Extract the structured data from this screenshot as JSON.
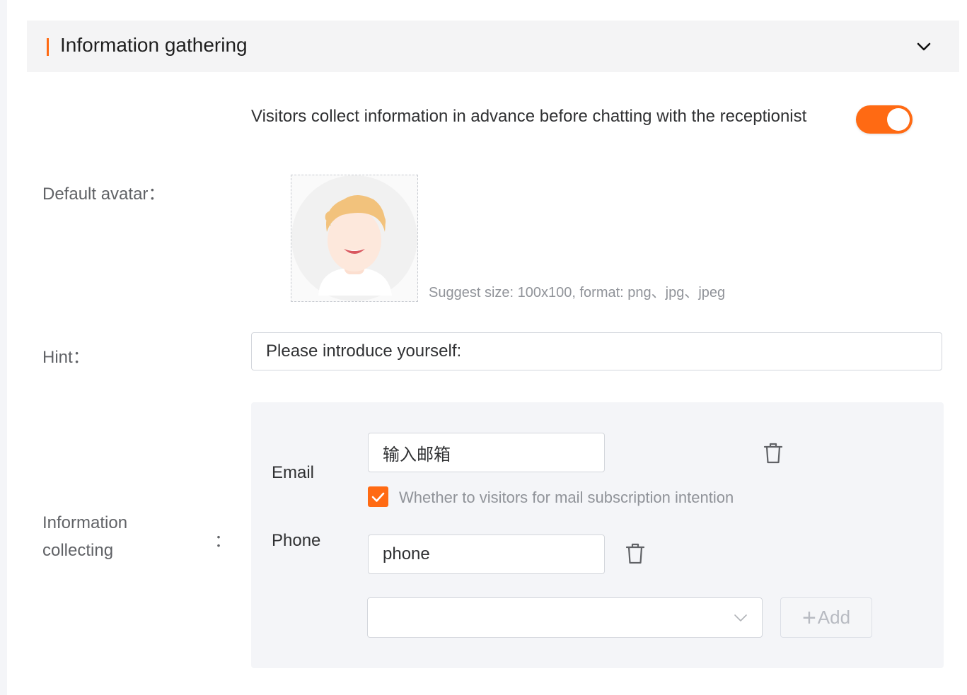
{
  "section": {
    "title": "Information gathering"
  },
  "pre_chat": {
    "label": "Visitors collect information in advance before chatting with the receptionist",
    "enabled": true
  },
  "avatar": {
    "label": "Default avatar：",
    "hint": "Suggest size: 100x100, format: png、jpg、jpeg"
  },
  "hint": {
    "label": "Hint：",
    "value": "Please introduce yourself:"
  },
  "info_collecting": {
    "label": "Information collecting",
    "colon": "：",
    "items": [
      {
        "label": "Email",
        "value": "输入邮箱"
      },
      {
        "label": "Phone",
        "value": "phone"
      }
    ],
    "mail_subscription": {
      "label": "Whether to visitors for mail subscription intention",
      "checked": true
    },
    "add_select": {
      "value": ""
    },
    "add_button_label": "Add"
  },
  "colors": {
    "accent": "#ff6a13",
    "panel_bg": "#f4f5f8"
  },
  "icons": {
    "collapse": "chevron-down-icon",
    "delete": "trash-icon",
    "check": "check-icon",
    "select": "chevron-down-icon",
    "add": "plus-icon"
  }
}
